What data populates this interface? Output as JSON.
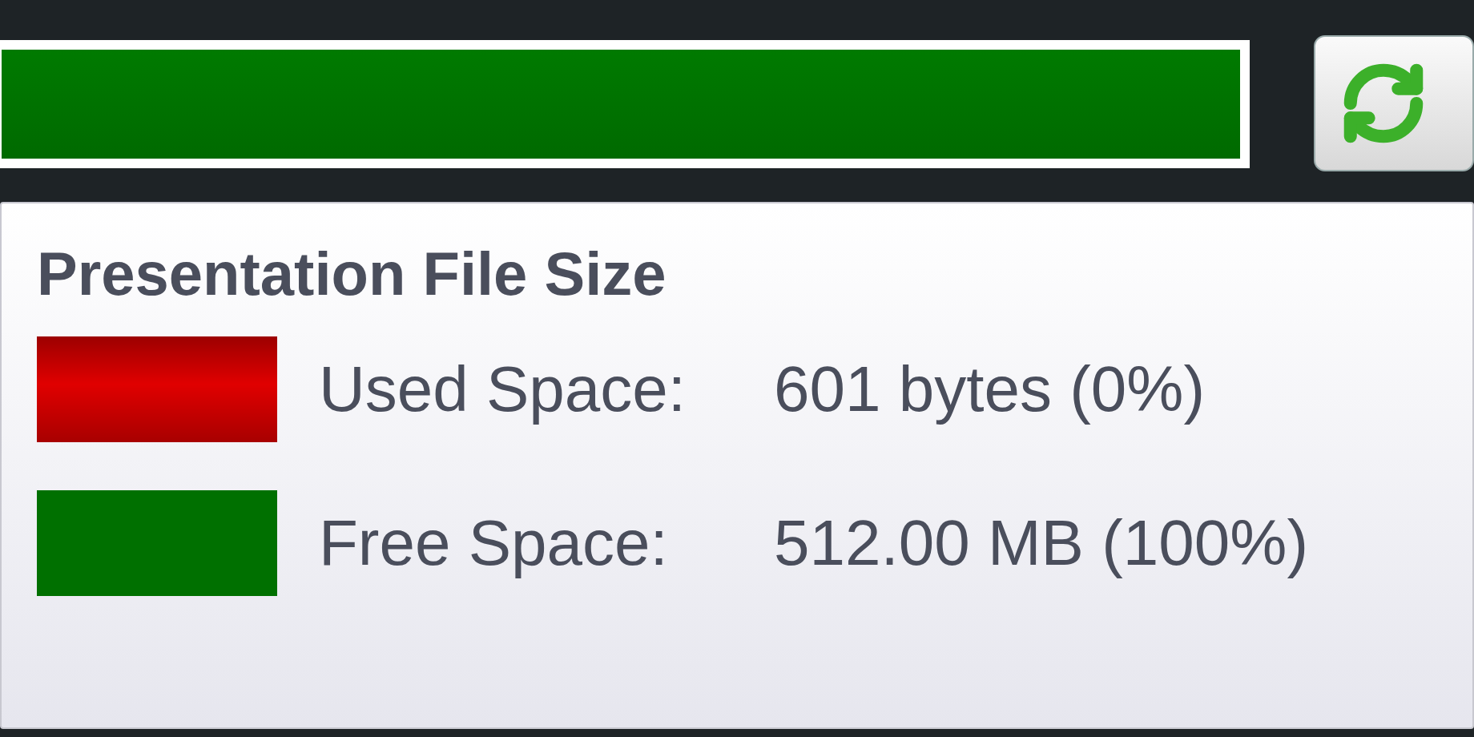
{
  "usage_bar": {
    "level": 0
  },
  "tooltip": {
    "title": "Presentation File Size",
    "rows": [
      {
        "kind": "used",
        "label": "Used Space:",
        "value": "601 bytes (0%)",
        "color": "#e00000"
      },
      {
        "kind": "free",
        "label": "Free Space:",
        "value": "512.00 MB (100%)",
        "color": "#007000"
      }
    ]
  }
}
